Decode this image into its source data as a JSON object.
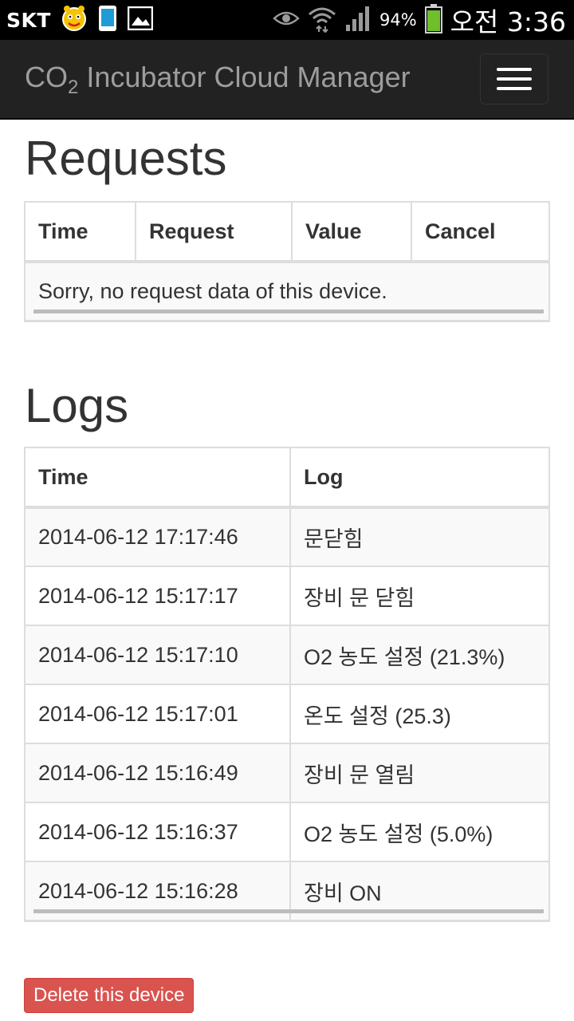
{
  "status_bar": {
    "carrier": "SKT",
    "battery_percent": "94%",
    "time": "오전 3:36",
    "battery_level": 0.94,
    "icons": [
      "alarm-app-icon",
      "phone-icon",
      "image-icon",
      "eye-icon",
      "wifi-icon",
      "signal-icon",
      "battery-icon"
    ]
  },
  "navbar": {
    "brand_prefix": "CO",
    "brand_sub": "2",
    "brand_suffix": " Incubator Cloud Manager",
    "menu_icon": "hamburger-icon"
  },
  "requests": {
    "title": "Requests",
    "columns": [
      "Time",
      "Request",
      "Value",
      "Cancel"
    ],
    "empty_message": "Sorry, no request data of this device."
  },
  "logs": {
    "title": "Logs",
    "columns": [
      "Time",
      "Log"
    ],
    "rows": [
      {
        "time": "2014-06-12 17:17:46",
        "log": "문닫힘"
      },
      {
        "time": "2014-06-12 15:17:17",
        "log": "장비 문 닫힘"
      },
      {
        "time": "2014-06-12 15:17:10",
        "log": "O2 농도 설정 (21.3%)"
      },
      {
        "time": "2014-06-12 15:17:01",
        "log": "온도 설정 (25.3)"
      },
      {
        "time": "2014-06-12 15:16:49",
        "log": "장비 문 열림"
      },
      {
        "time": "2014-06-12 15:16:37",
        "log": "O2 농도 설정 (5.0%)"
      },
      {
        "time": "2014-06-12 15:16:28",
        "log": "장비 ON"
      }
    ]
  },
  "actions": {
    "delete_label": "Delete this device"
  },
  "colors": {
    "navbar_bg": "#222222",
    "brand_text": "#9d9d9d",
    "danger": "#d9534f",
    "battery_green": "#6fbf2a"
  }
}
